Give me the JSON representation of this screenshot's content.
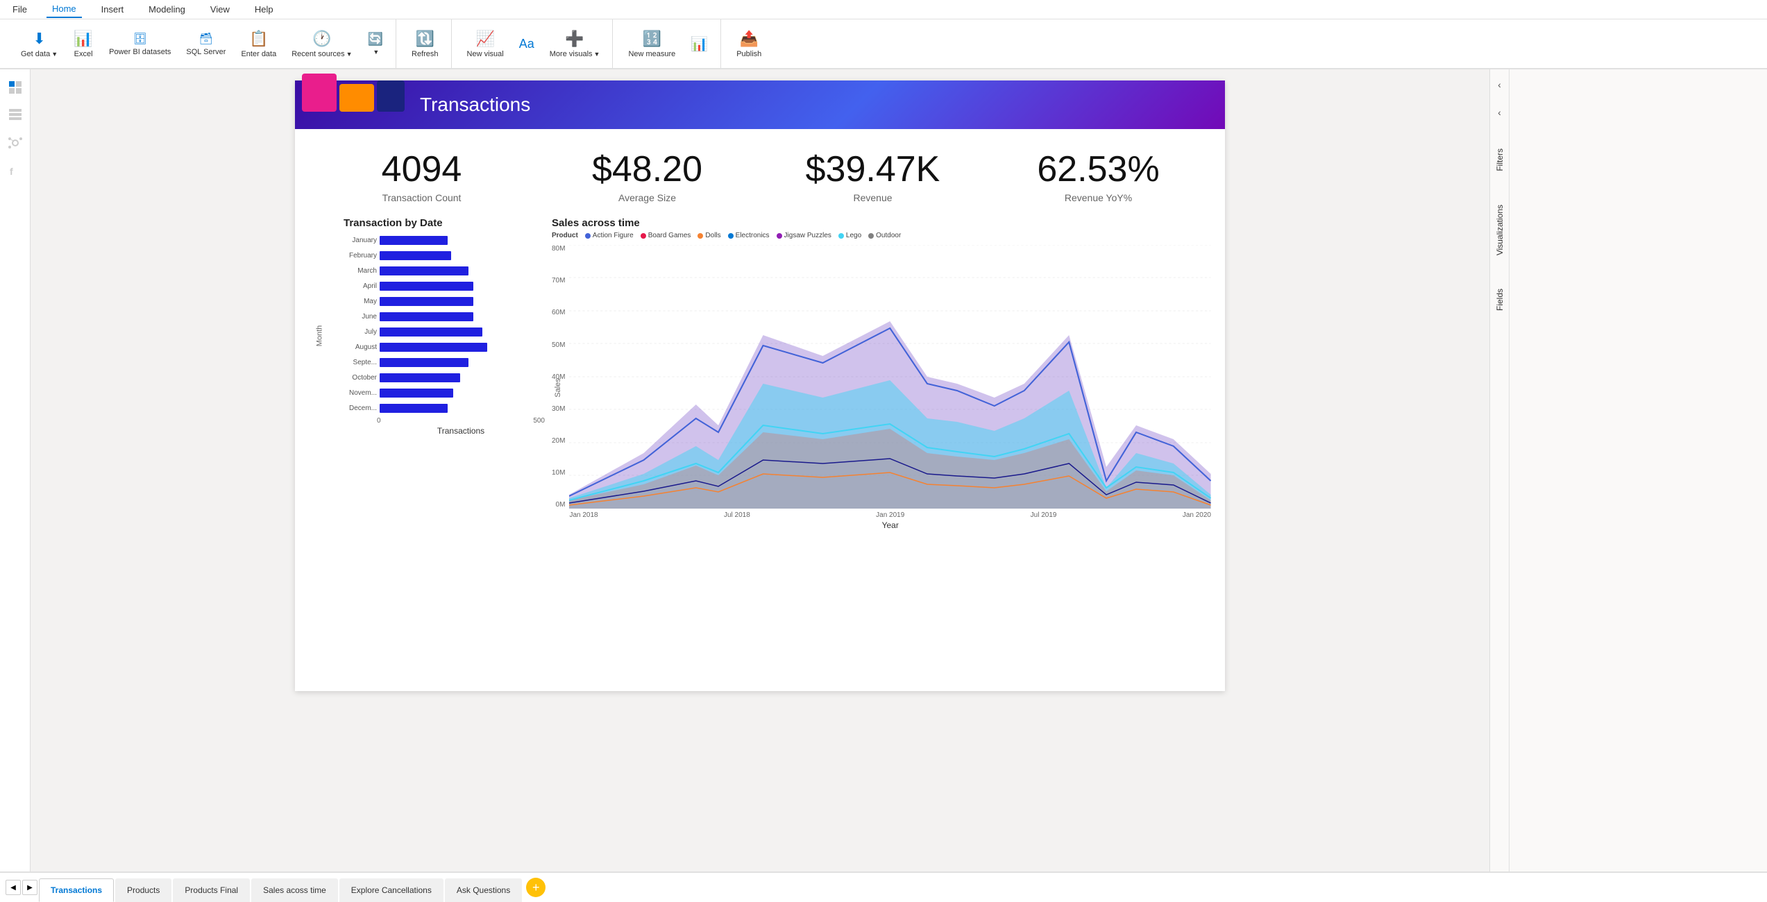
{
  "menu": {
    "items": [
      {
        "id": "file",
        "label": "File"
      },
      {
        "id": "home",
        "label": "Home",
        "active": true
      },
      {
        "id": "insert",
        "label": "Insert"
      },
      {
        "id": "modeling",
        "label": "Modeling"
      },
      {
        "id": "view",
        "label": "View"
      },
      {
        "id": "help",
        "label": "Help"
      }
    ]
  },
  "toolbar": {
    "items": [
      {
        "id": "get-data",
        "label": "Get data",
        "icon": "⬇",
        "has_arrow": true
      },
      {
        "id": "excel",
        "label": "Excel",
        "icon": "📊"
      },
      {
        "id": "power-bi-datasets",
        "label": "Power BI datasets",
        "icon": "🗄"
      },
      {
        "id": "sql-server",
        "label": "SQL Server",
        "icon": "🗃"
      },
      {
        "id": "enter-data",
        "label": "Enter data",
        "icon": "📋"
      },
      {
        "id": "recent-sources",
        "label": "Recent sources",
        "icon": "🕐",
        "has_arrow": true
      },
      {
        "id": "transform",
        "label": "",
        "icon": "🔄",
        "has_arrow": true
      },
      {
        "id": "refresh",
        "label": "Refresh",
        "icon": "🔃"
      },
      {
        "id": "new-visual",
        "label": "New visual",
        "icon": "📈"
      },
      {
        "id": "more-visuals",
        "label": "More visuals",
        "icon": "➕",
        "has_arrow": true
      },
      {
        "id": "new-measure",
        "label": "New measure",
        "icon": "🔢"
      },
      {
        "id": "quick-calc",
        "label": "",
        "icon": "⚡"
      },
      {
        "id": "publish",
        "label": "Publish",
        "icon": "📤"
      }
    ]
  },
  "report": {
    "banner_title": "Transactions",
    "kpis": [
      {
        "value": "4094",
        "label": "Transaction Count"
      },
      {
        "value": "$48.20",
        "label": "Average Size"
      },
      {
        "value": "$39.47K",
        "label": "Revenue"
      },
      {
        "value": "62.53%",
        "label": "Revenue YoY%"
      }
    ],
    "bar_chart": {
      "title": "Transaction by Date",
      "y_axis_label": "Month",
      "x_axis_label": "Transactions",
      "x_ticks": [
        "0",
        "500"
      ],
      "bars": [
        {
          "name": "January",
          "pct": 40
        },
        {
          "name": "February",
          "pct": 42
        },
        {
          "name": "March",
          "pct": 52
        },
        {
          "name": "April",
          "pct": 55
        },
        {
          "name": "May",
          "pct": 55
        },
        {
          "name": "June",
          "pct": 55
        },
        {
          "name": "July",
          "pct": 60
        },
        {
          "name": "August",
          "pct": 63
        },
        {
          "name": "Septe...",
          "pct": 52
        },
        {
          "name": "October",
          "pct": 47
        },
        {
          "name": "Novem...",
          "pct": 43
        },
        {
          "name": "Decem...",
          "pct": 40
        }
      ]
    },
    "area_chart": {
      "title": "Sales across time",
      "legend_label": "Product",
      "legend_items": [
        {
          "label": "Action Figure",
          "color": "#4363d8"
        },
        {
          "label": "Board Games",
          "color": "#e6194b"
        },
        {
          "label": "Dolls",
          "color": "#f58231"
        },
        {
          "label": "Electronics",
          "color": "#0078d4"
        },
        {
          "label": "Jigsaw Puzzles",
          "color": "#911eb4"
        },
        {
          "label": "Lego",
          "color": "#42d4f4"
        },
        {
          "label": "Outdoor",
          "color": "#808080"
        }
      ],
      "y_ticks": [
        "0M",
        "10M",
        "20M",
        "30M",
        "40M",
        "50M",
        "60M",
        "70M",
        "80M"
      ],
      "x_ticks": [
        "Jan 2018",
        "Jul 2018",
        "Jan 2019",
        "Jul 2019",
        "Jan 2020"
      ],
      "x_axis_label": "Year",
      "y_axis_label": "Sales"
    }
  },
  "panels": {
    "filters_label": "Filters",
    "visualizations_label": "Visualizations",
    "fields_label": "Fields"
  },
  "tabs": {
    "items": [
      {
        "id": "transactions",
        "label": "Transactions",
        "active": true
      },
      {
        "id": "products",
        "label": "Products"
      },
      {
        "id": "products-final",
        "label": "Products Final"
      },
      {
        "id": "sales-across-time",
        "label": "Sales acoss time"
      },
      {
        "id": "explore-cancellations",
        "label": "Explore Cancellations"
      },
      {
        "id": "ask-questions",
        "label": "Ask Questions"
      }
    ],
    "add_label": "+"
  }
}
